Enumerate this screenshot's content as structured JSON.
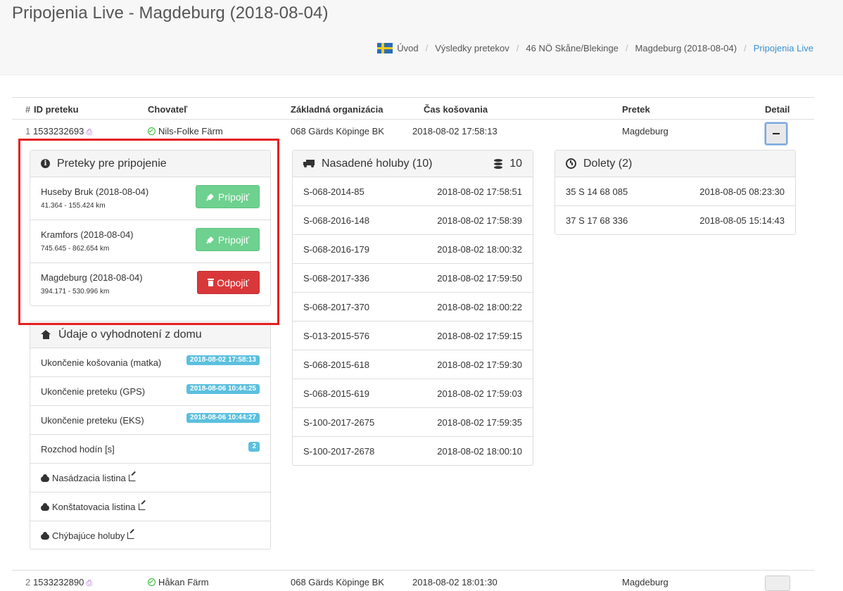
{
  "header": {
    "title": "Pripojenia Live - Magdeburg (2018-08-04)",
    "breadcrumb": [
      "Úvod",
      "Výsledky pretekov",
      "46 NÖ Skåne/Blekinge",
      "Magdeburg (2018-08-04)",
      "Pripojenia Live"
    ]
  },
  "table": {
    "headers": {
      "hash": "#",
      "race_id": "ID preteku",
      "breeder": "Chovateľ",
      "org": "Základná organizácia",
      "basket_time": "Čas košovania",
      "race": "Pretek",
      "detail": "Detail"
    },
    "rows": [
      {
        "num": "1",
        "race_id": "1533232693",
        "breeder": "Nils-Folke Färm",
        "org": "068 Gärds Köpinge BK",
        "basket_time": "2018-08-02 17:58:13",
        "race": "Magdeburg"
      },
      {
        "num": "2",
        "race_id": "1533232890",
        "breeder": "Håkan Färm",
        "org": "068 Gärds Köpinge BK",
        "basket_time": "2018-08-02 18:01:30",
        "race": "Magdeburg"
      }
    ]
  },
  "connections": {
    "title": "Preteky pre pripojenie",
    "items": [
      {
        "name": "Huseby Bruk (2018-08-04)",
        "distance": "41.364 - 155.424 km",
        "action": "Pripojiť",
        "type": "connect"
      },
      {
        "name": "Kramfors (2018-08-04)",
        "distance": "745.645 - 862.654 km",
        "action": "Pripojiť",
        "type": "connect"
      },
      {
        "name": "Magdeburg (2018-08-04)",
        "distance": "394.171 - 530.996 km",
        "action": "Odpojiť",
        "type": "disconnect"
      }
    ]
  },
  "home_eval": {
    "title": "Údaje o vyhodnotení z domu",
    "items": [
      {
        "label": "Ukončenie košovania (matka)",
        "badge": "2018-08-02 17:58:13"
      },
      {
        "label": "Ukončenie preteku (GPS)",
        "badge": "2018-08-06 10:44:25"
      },
      {
        "label": "Ukončenie preteku (EKS)",
        "badge": "2018-08-06 10:44:27"
      },
      {
        "label": "Rozchod hodín [s]",
        "badge": "2"
      }
    ],
    "links": [
      "Nasádzacia listina",
      "Konštatovacia listina",
      "Chýbajúce holuby"
    ]
  },
  "basketed": {
    "title": "Nasadené holuby (10)",
    "count": "10",
    "pigeons": [
      {
        "ring": "S-068-2014-85",
        "time": "2018-08-02 17:58:51"
      },
      {
        "ring": "S-068-2016-148",
        "time": "2018-08-02 17:58:39"
      },
      {
        "ring": "S-068-2016-179",
        "time": "2018-08-02 18:00:32"
      },
      {
        "ring": "S-068-2017-336",
        "time": "2018-08-02 17:59:50"
      },
      {
        "ring": "S-068-2017-370",
        "time": "2018-08-02 18:00:22"
      },
      {
        "ring": "S-013-2015-576",
        "time": "2018-08-02 17:59:15"
      },
      {
        "ring": "S-068-2015-618",
        "time": "2018-08-02 17:59:30"
      },
      {
        "ring": "S-068-2015-619",
        "time": "2018-08-02 17:59:03"
      },
      {
        "ring": "S-100-2017-2675",
        "time": "2018-08-02 17:59:35"
      },
      {
        "ring": "S-100-2017-2678",
        "time": "2018-08-02 18:00:10"
      }
    ]
  },
  "arrivals": {
    "title": "Dolety (2)",
    "items": [
      {
        "ring": "35 S 14 68 085",
        "time": "2018-08-05 08:23:30"
      },
      {
        "ring": "37 S 17 68 336",
        "time": "2018-08-05 15:14:43"
      }
    ]
  },
  "colors": {
    "connect": "#6ed18f",
    "disconnect": "#d9383a",
    "badge": "#5bc0de",
    "highlight": "#e41f1f",
    "link": "#3a8fd1"
  }
}
